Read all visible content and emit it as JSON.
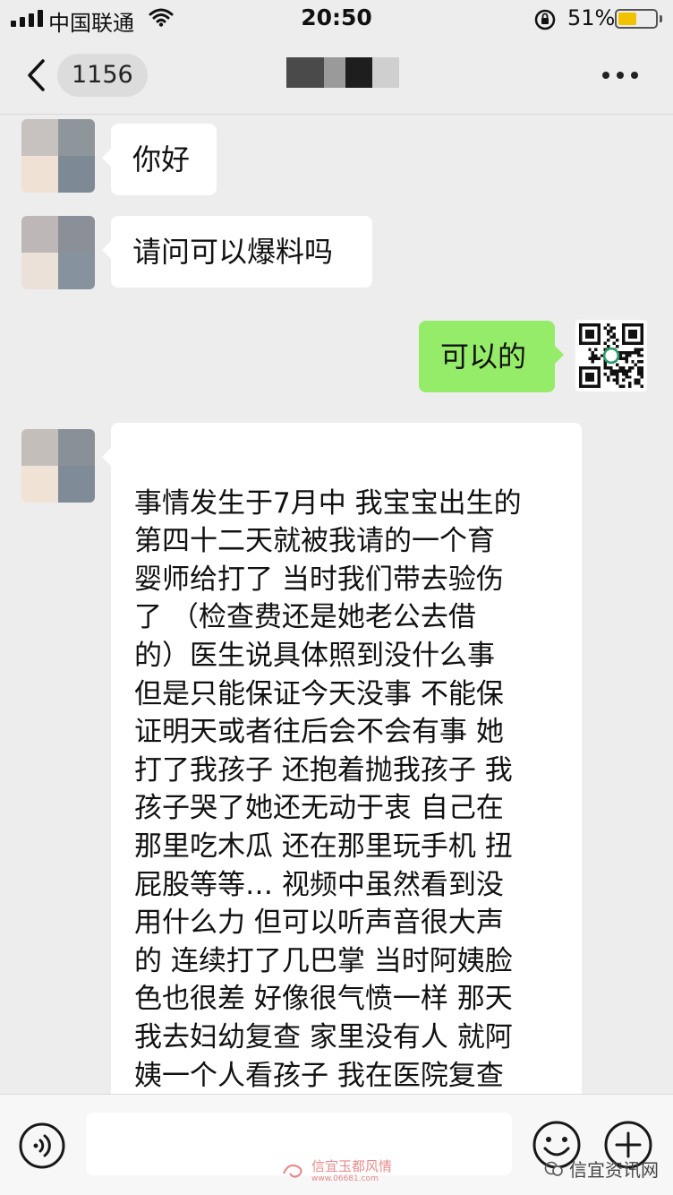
{
  "status_bar": {
    "carrier": "中国联通",
    "time": "20:50",
    "battery_percent": "51%",
    "battery_level": 0.51,
    "icons": [
      "signal-icon",
      "wifi-icon",
      "orientation-lock-icon",
      "battery-icon"
    ]
  },
  "nav": {
    "back_icon": "chevron-left-icon",
    "unread_count": "1156",
    "title": "",
    "title_mask_colors": [
      "#4a4a4a",
      "#9a9a9a",
      "#1e1e1e",
      "#cfcfcf"
    ],
    "more_icon": "more-dots-icon"
  },
  "messages": [
    {
      "side": "in",
      "text": "你好",
      "avatar_colors": [
        "#c7c2c0",
        "#8e969c",
        "#efe2d4",
        "#7d8a96"
      ]
    },
    {
      "side": "in",
      "text": "请问可以爆料吗",
      "avatar_colors": [
        "#bdb8b7",
        "#8b8f97",
        "#ece1d8",
        "#86939e"
      ]
    },
    {
      "side": "out",
      "text": "可以的"
    },
    {
      "side": "in",
      "text": "事情发生于7月中 我宝宝出生的\n第四十二天就被我请的一个育\n婴师给打了 当时我们带去验伤\n了 （检查费还是她老公去借\n的）医生说具体照到没什么事\n但是只能保证今天没事 不能保\n证明天或者往后会不会有事 她\n打了我孩子 还抱着抛我孩子 我\n孩子哭了她还无动于衷 自己在\n那里吃木瓜 还在那里玩手机 扭\n屁股等等… 视频中虽然看到没\n用什么力 但可以听声音很大声\n的 连续打了几巴掌 当时阿姨脸\n色也很差 好像很气愤一样 那天\n我去妇幼复查 家里没有人 就阿\n姨一个人看孩子 我在医院复查\n看摄像头才发现她打我孩子 后\n来我们处理完事情 她有我家或",
      "avatar_colors": [
        "#c4bebb",
        "#8a9098",
        "#f0e3d6",
        "#7f8b97"
      ]
    }
  ],
  "colors": {
    "chat_background": "#ededed",
    "incoming_bubble": "#ffffff",
    "outgoing_bubble": "#95ec69"
  },
  "input_bar": {
    "voice_icon": "voice-input-icon",
    "text_value": "",
    "emoji_icon": "emoji-icon",
    "plus_icon": "plus-circle-icon"
  },
  "watermarks": {
    "site_name": "信宜玉都风情",
    "site_url": "www.06681.com",
    "account_name": "信宜资讯网"
  }
}
